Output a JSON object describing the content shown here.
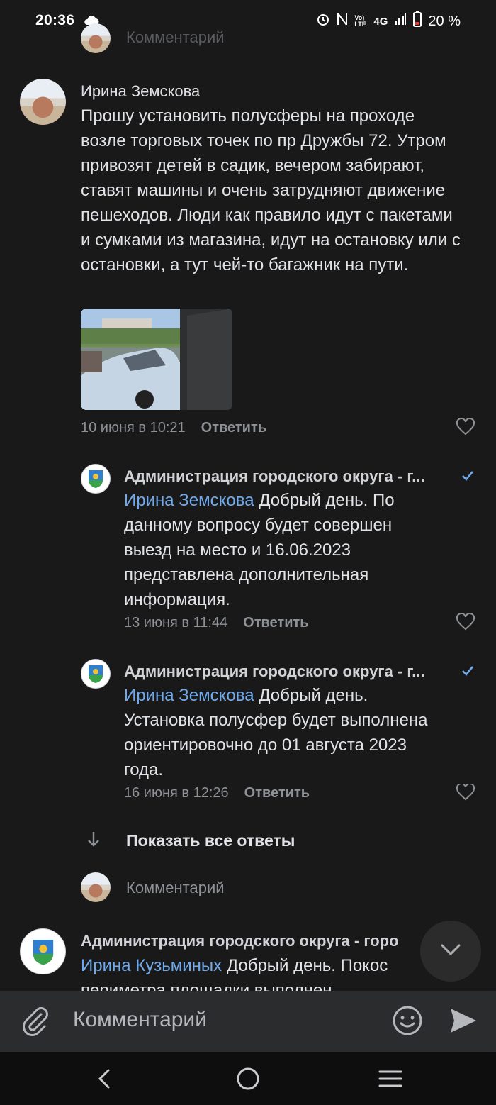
{
  "status_bar": {
    "time": "20:36",
    "network": "4G",
    "volte": "Vo) LTE",
    "battery": "20 %"
  },
  "top_partial": {
    "placeholder": "Комментарий"
  },
  "comments": [
    {
      "author": "Ирина Земскова",
      "text": "Прошу установить полусферы на проходе возле торговых точек по пр Дружбы 72. Утром привозят детей в садик, вечером забирают,  ставят машины и очень затрудняют движение пешеходов. Люди как правило идут с пакетами и сумками из магазина, идут на остановку или с остановки, а тут чей-то багажник на пути.",
      "date": "10 июня в 10:21",
      "reply_label": "Ответить"
    }
  ],
  "replies": [
    {
      "author": "Администрация городского округа - г...",
      "mention": "Ирина Земскова",
      "text_lines": [
        "Добрый день. По",
        "данному вопросу будет совершен",
        "выезд на место и 16.06.2023",
        "представлена дополнительная",
        "информация."
      ],
      "date": "13 июня в 11:44",
      "reply_label": "Ответить"
    },
    {
      "author": "Администрация городского округа - г...",
      "mention": "Ирина Земскова",
      "text_lines": [
        "Добрый день.",
        "Установка полусфер будет выполнена",
        "ориентировочно до 01 августа 2023",
        "года."
      ],
      "date": "16 июня в 12:26",
      "reply_label": "Ответить"
    }
  ],
  "show_all_replies": "Показать все ответы",
  "reply_input_placeholder": "Комментарий",
  "next_comment": {
    "author": "Администрация городского округа - горо",
    "mention": "Ирина Кузьминых",
    "text": "Добрый день. Покос",
    "text_cut": "периметра площадки выполнен"
  },
  "composer": {
    "placeholder": "Комментарий"
  },
  "icons": [
    "attach-icon",
    "emoji-icon",
    "send-icon",
    "chevron-down-icon",
    "heart-icon",
    "verified-icon",
    "arrow-down-icon",
    "back-icon",
    "home-icon",
    "recents-icon"
  ],
  "colors": {
    "background": "#19191a",
    "mention": "#71aaeb",
    "verified": "#71aaeb",
    "secondary": "#8e9196"
  }
}
